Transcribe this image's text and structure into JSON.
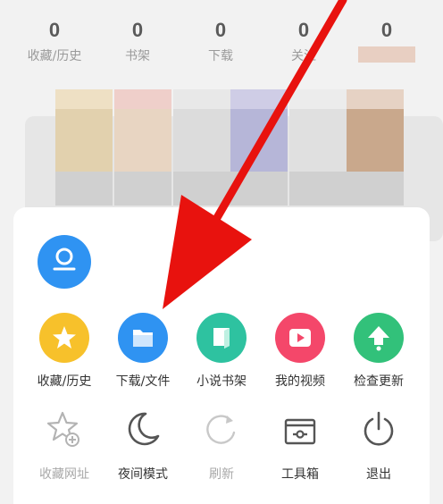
{
  "stats": [
    {
      "count": "0",
      "label": "收藏/历史"
    },
    {
      "count": "0",
      "label": "书架"
    },
    {
      "count": "0",
      "label": "下载"
    },
    {
      "count": "0",
      "label": "关注"
    },
    {
      "count": "0",
      "label": ""
    }
  ],
  "menu": {
    "row1": [
      {
        "label": "收藏/历史",
        "icon": "star-icon",
        "color": "#f7c12b"
      },
      {
        "label": "下载/文件",
        "icon": "folder-icon",
        "color": "#2f93f2"
      },
      {
        "label": "小说书架",
        "icon": "book-icon",
        "color": "#2ec2a0"
      },
      {
        "label": "我的视频",
        "icon": "video-play-icon",
        "color": "#f4476a"
      },
      {
        "label": "检查更新",
        "icon": "update-arrow-icon",
        "color": "#32c17a"
      }
    ],
    "row2": [
      {
        "label": "收藏网址",
        "icon": "star-add-icon"
      },
      {
        "label": "夜间模式",
        "icon": "moon-icon"
      },
      {
        "label": "刷新",
        "icon": "refresh-icon"
      },
      {
        "label": "工具箱",
        "icon": "toolbox-icon"
      },
      {
        "label": "退出",
        "icon": "power-icon"
      }
    ]
  },
  "colors": {
    "arrow": "#e8120e",
    "accent": "#2f93f2"
  }
}
